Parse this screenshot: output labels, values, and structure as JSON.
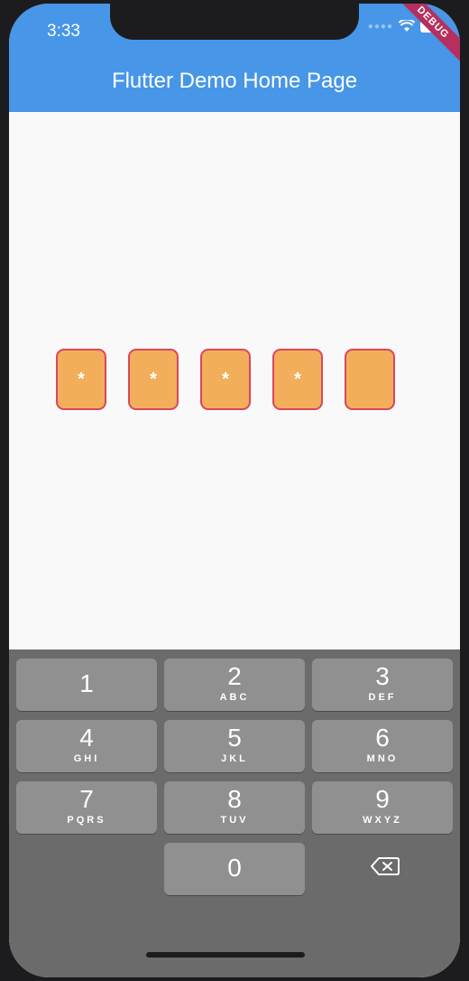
{
  "status_bar": {
    "time": "3:33"
  },
  "debug_banner": "DEBUG",
  "app_bar": {
    "title": "Flutter Demo Home Page"
  },
  "pin": {
    "boxes": [
      "*",
      "*",
      "*",
      "*",
      ""
    ],
    "colors": {
      "fill": "#f2ae5b",
      "border": "#d9475c"
    }
  },
  "keypad": {
    "keys": [
      {
        "num": "1",
        "letters": ""
      },
      {
        "num": "2",
        "letters": "ABC"
      },
      {
        "num": "3",
        "letters": "DEF"
      },
      {
        "num": "4",
        "letters": "GHI"
      },
      {
        "num": "5",
        "letters": "JKL"
      },
      {
        "num": "6",
        "letters": "MNO"
      },
      {
        "num": "7",
        "letters": "PQRS"
      },
      {
        "num": "8",
        "letters": "TUV"
      },
      {
        "num": "9",
        "letters": "WXYZ"
      },
      {
        "num": "0",
        "letters": ""
      }
    ],
    "delete_icon": "backspace-icon"
  },
  "colors": {
    "app_bar": "#4796e8",
    "keyboard_bg": "#6b6b6b",
    "key_bg": "#909090"
  }
}
